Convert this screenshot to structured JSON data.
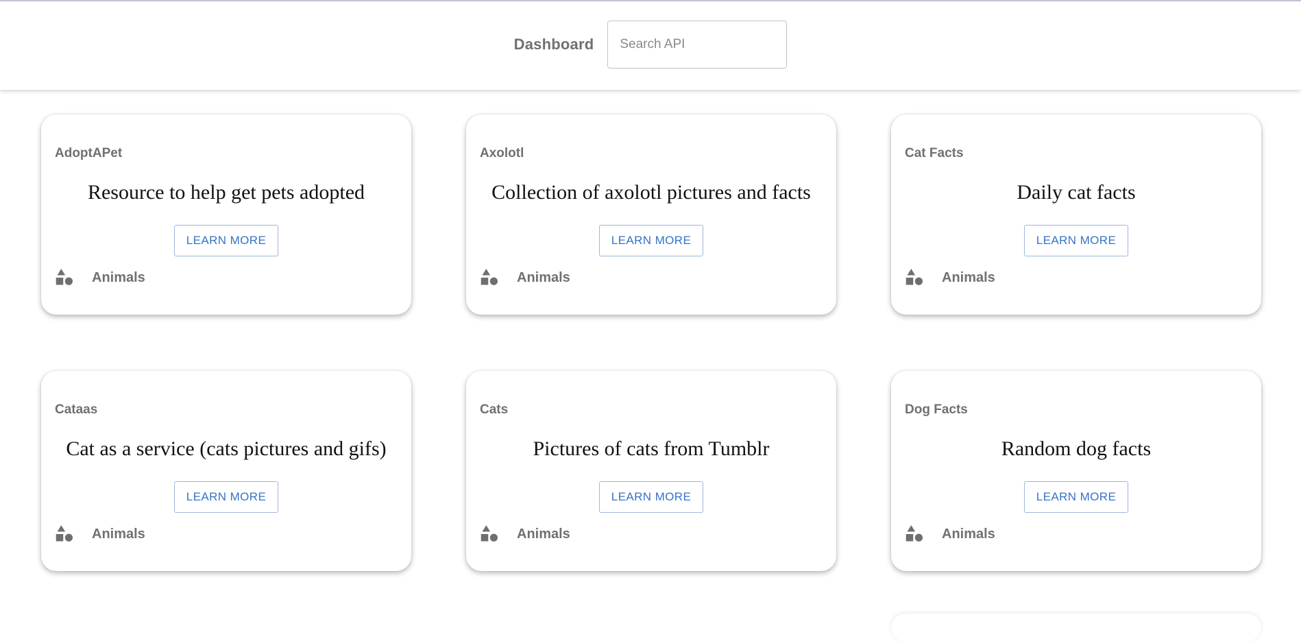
{
  "header": {
    "title": "Dashboard",
    "search_placeholder": "Search API",
    "search_value": ""
  },
  "cards": [
    {
      "name": "AdoptAPet",
      "description": "Resource to help get pets adopted",
      "button": "LEARN MORE",
      "category": "Animals",
      "category_icon": "shapes-icon"
    },
    {
      "name": "Axolotl",
      "description": "Collection of axolotl pictures and facts",
      "button": "LEARN MORE",
      "category": "Animals",
      "category_icon": "shapes-icon"
    },
    {
      "name": "Cat Facts",
      "description": "Daily cat facts",
      "button": "LEARN MORE",
      "category": "Animals",
      "category_icon": "shapes-icon"
    },
    {
      "name": "Cataas",
      "description": "Cat as a service (cats pictures and gifs)",
      "button": "LEARN MORE",
      "category": "Animals",
      "category_icon": "shapes-icon"
    },
    {
      "name": "Cats",
      "description": "Pictures of cats from Tumblr",
      "button": "LEARN MORE",
      "category": "Animals",
      "category_icon": "shapes-icon"
    },
    {
      "name": "Dog Facts",
      "description": "Random dog facts",
      "button": "LEARN MORE",
      "category": "Animals",
      "category_icon": "shapes-icon"
    }
  ],
  "colors": {
    "accent": "#3473c8",
    "muted_text": "#707070",
    "top_line": "#c9c6e0"
  }
}
